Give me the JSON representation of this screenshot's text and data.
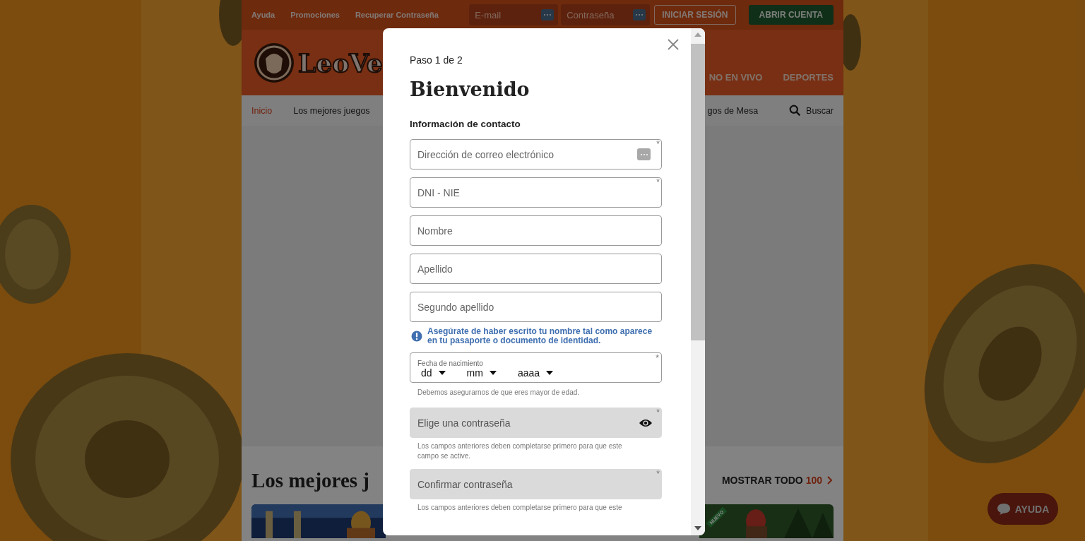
{
  "topbar": {
    "links": [
      "Ayuda",
      "Promociones",
      "Recuperar Contraseña"
    ],
    "email_placeholder": "E-mail",
    "password_placeholder": "Contraseña",
    "login": "INICIAR SESIÓN",
    "signup": "ABRIR CUENTA"
  },
  "header": {
    "logo": "LeoVe",
    "nav_right": [
      "NO EN VIVO",
      "DEPORTES"
    ]
  },
  "nav": {
    "items": [
      {
        "label": "Inicio",
        "selected": true
      },
      {
        "label": "Los mejores juegos",
        "selected": false
      }
    ],
    "right_item": "gos de Mesa",
    "search": "Buscar"
  },
  "section": {
    "title": "Los mejores j",
    "show_all": "MOSTRAR TODO",
    "count": "100",
    "ribbon": "NUEVO"
  },
  "help": "AYUDA",
  "modal": {
    "step": "Paso 1 de 2",
    "title": "Bienvenido",
    "subtitle": "Información de contacto",
    "fields": [
      {
        "kind": "email",
        "placeholder": "Dirección de correo electrónico",
        "mark": "*",
        "disabled": false
      },
      {
        "kind": "text",
        "placeholder": "DNI - NIE",
        "mark": "*",
        "disabled": false
      },
      {
        "kind": "text",
        "placeholder": "Nombre",
        "disabled": false
      },
      {
        "kind": "text",
        "placeholder": "Apellido",
        "disabled": false
      },
      {
        "kind": "text",
        "placeholder": "Segundo apellido",
        "disabled": false
      },
      {
        "kind": "notice",
        "text": "Asegúrate de haber escrito tu nombre tal como aparece en tu pasaporte o documento de identidad."
      },
      {
        "kind": "date",
        "label": "Fecha de nacimiento",
        "mark": "*",
        "parts": [
          "dd",
          "mm",
          "aaaa"
        ],
        "hint": "Debemos asegurarnos de que eres mayor de edad."
      },
      {
        "kind": "password",
        "placeholder": "Elige una contraseña",
        "mark": "*",
        "disabled": true,
        "hint": "Los campos anteriores deben completarse primero para que este campo se active."
      },
      {
        "kind": "confirm",
        "placeholder": "Confirmar contraseña",
        "mark": "*",
        "disabled": true,
        "hint": "Los campos anteriores deben completarse primero para que este"
      }
    ]
  }
}
